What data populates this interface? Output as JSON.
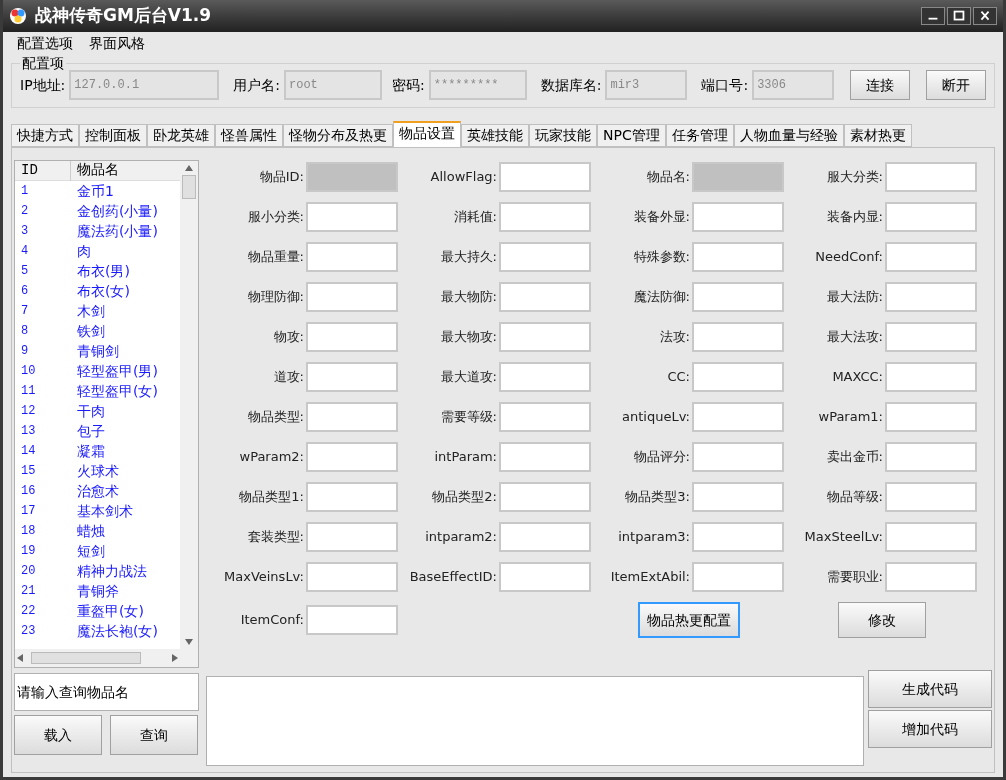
{
  "window": {
    "title": "战神传奇GM后台V1.9"
  },
  "menu": [
    "配置选项",
    "界面风格"
  ],
  "connection": {
    "group_title": "配置项",
    "fields": [
      {
        "label": "IP地址:",
        "value": "127.0.0.1"
      },
      {
        "label": "用户名:",
        "value": "root"
      },
      {
        "label": "密码:",
        "value": "*********"
      },
      {
        "label": "数据库名:",
        "value": "mir3"
      },
      {
        "label": "端口号:",
        "value": "3306"
      }
    ],
    "buttons": [
      "连接",
      "断开"
    ]
  },
  "tabs": [
    {
      "label": "快捷方式",
      "selected": false
    },
    {
      "label": "控制面板",
      "selected": false
    },
    {
      "label": "卧龙英雄",
      "selected": false
    },
    {
      "label": "怪兽属性",
      "selected": false
    },
    {
      "label": "怪物分布及热更",
      "selected": false
    },
    {
      "label": "物品设置",
      "selected": true
    },
    {
      "label": "英雄技能",
      "selected": false
    },
    {
      "label": "玩家技能",
      "selected": false
    },
    {
      "label": "NPC管理",
      "selected": false
    },
    {
      "label": "任务管理",
      "selected": false
    },
    {
      "label": "人物血量与经验",
      "selected": false
    },
    {
      "label": "素材热更",
      "selected": false
    }
  ],
  "item_list": {
    "columns": [
      "ID",
      "物品名"
    ],
    "rows": [
      [
        "1",
        "金币1"
      ],
      [
        "2",
        "金创药(小量)"
      ],
      [
        "3",
        "魔法药(小量)"
      ],
      [
        "4",
        "肉"
      ],
      [
        "5",
        "布衣(男)"
      ],
      [
        "6",
        "布衣(女)"
      ],
      [
        "7",
        "木剑"
      ],
      [
        "8",
        "铁剑"
      ],
      [
        "9",
        "青铜剑"
      ],
      [
        "10",
        "轻型盔甲(男)"
      ],
      [
        "11",
        "轻型盔甲(女)"
      ],
      [
        "12",
        "干肉"
      ],
      [
        "13",
        "包子"
      ],
      [
        "14",
        "凝霜"
      ],
      [
        "15",
        "火球术"
      ],
      [
        "16",
        "治愈术"
      ],
      [
        "17",
        "基本剑术"
      ],
      [
        "18",
        "蜡烛"
      ],
      [
        "19",
        "短剑"
      ],
      [
        "20",
        "精神力战法"
      ],
      [
        "21",
        "青铜斧"
      ],
      [
        "22",
        "重盔甲(女)"
      ],
      [
        "23",
        "魔法长袍(女)"
      ]
    ]
  },
  "search": {
    "placeholder": "请输入查询物品名"
  },
  "left_buttons": [
    "载入",
    "查询"
  ],
  "form_rows": [
    [
      {
        "kind": "field",
        "label": "物品ID:",
        "disabled": true
      },
      {
        "kind": "field",
        "label": "AllowFlag:",
        "disabled": false
      },
      {
        "kind": "field",
        "label": "物品名:",
        "disabled": true
      },
      {
        "kind": "field",
        "label": "服大分类:",
        "disabled": false
      }
    ],
    [
      {
        "kind": "field",
        "label": "服小分类:",
        "disabled": false
      },
      {
        "kind": "field",
        "label": "消耗值:",
        "disabled": false
      },
      {
        "kind": "field",
        "label": "装备外显:",
        "disabled": false
      },
      {
        "kind": "field",
        "label": "装备内显:",
        "disabled": false
      }
    ],
    [
      {
        "kind": "field",
        "label": "物品重量:",
        "disabled": false
      },
      {
        "kind": "field",
        "label": "最大持久:",
        "disabled": false
      },
      {
        "kind": "field",
        "label": "特殊参数:",
        "disabled": false
      },
      {
        "kind": "field",
        "label": "NeedConf:",
        "disabled": false
      }
    ],
    [
      {
        "kind": "field",
        "label": "物理防御:",
        "disabled": false
      },
      {
        "kind": "field",
        "label": "最大物防:",
        "disabled": false
      },
      {
        "kind": "field",
        "label": "魔法防御:",
        "disabled": false
      },
      {
        "kind": "field",
        "label": "最大法防:",
        "disabled": false
      }
    ],
    [
      {
        "kind": "field",
        "label": "物攻:",
        "disabled": false
      },
      {
        "kind": "field",
        "label": "最大物攻:",
        "disabled": false
      },
      {
        "kind": "field",
        "label": "法攻:",
        "disabled": false
      },
      {
        "kind": "field",
        "label": "最大法攻:",
        "disabled": false
      }
    ],
    [
      {
        "kind": "field",
        "label": "道攻:",
        "disabled": false
      },
      {
        "kind": "field",
        "label": "最大道攻:",
        "disabled": false
      },
      {
        "kind": "field",
        "label": "CC:",
        "disabled": false
      },
      {
        "kind": "field",
        "label": "MAXCC:",
        "disabled": false
      }
    ],
    [
      {
        "kind": "field",
        "label": "物品类型:",
        "disabled": false
      },
      {
        "kind": "field",
        "label": "需要等级:",
        "disabled": false
      },
      {
        "kind": "field",
        "label": "antiqueLv:",
        "disabled": false
      },
      {
        "kind": "field",
        "label": "wParam1:",
        "disabled": false
      }
    ],
    [
      {
        "kind": "field",
        "label": "wParam2:",
        "disabled": false
      },
      {
        "kind": "field",
        "label": "intParam:",
        "disabled": false
      },
      {
        "kind": "field",
        "label": "物品评分:",
        "disabled": false
      },
      {
        "kind": "field",
        "label": "卖出金币:",
        "disabled": false
      }
    ],
    [
      {
        "kind": "field",
        "label": "物品类型1:",
        "disabled": false
      },
      {
        "kind": "field",
        "label": "物品类型2:",
        "disabled": false
      },
      {
        "kind": "field",
        "label": "物品类型3:",
        "disabled": false
      },
      {
        "kind": "field",
        "label": "物品等级:",
        "disabled": false
      }
    ],
    [
      {
        "kind": "field",
        "label": "套装类型:",
        "disabled": false
      },
      {
        "kind": "field",
        "label": "intparam2:",
        "disabled": false
      },
      {
        "kind": "field",
        "label": "intparam3:",
        "disabled": false
      },
      {
        "kind": "field",
        "label": "MaxSteelLv:",
        "disabled": false
      }
    ],
    [
      {
        "kind": "field",
        "label": "MaxVeinsLv:",
        "disabled": false
      },
      {
        "kind": "field",
        "label": "BaseEffectID:",
        "disabled": false
      },
      {
        "kind": "field",
        "label": "ItemExtAbil:",
        "disabled": false
      },
      {
        "kind": "field",
        "label": "需要职业:",
        "disabled": false
      }
    ],
    [
      {
        "kind": "field",
        "label": "ItemConf:",
        "disabled": false
      },
      {
        "kind": "empty"
      },
      {
        "kind": "button",
        "label": "物品热更配置",
        "focused": true
      },
      {
        "kind": "button",
        "label": "修改",
        "focused": false
      }
    ]
  ],
  "code_buttons": [
    "生成代码",
    "增加代码"
  ]
}
